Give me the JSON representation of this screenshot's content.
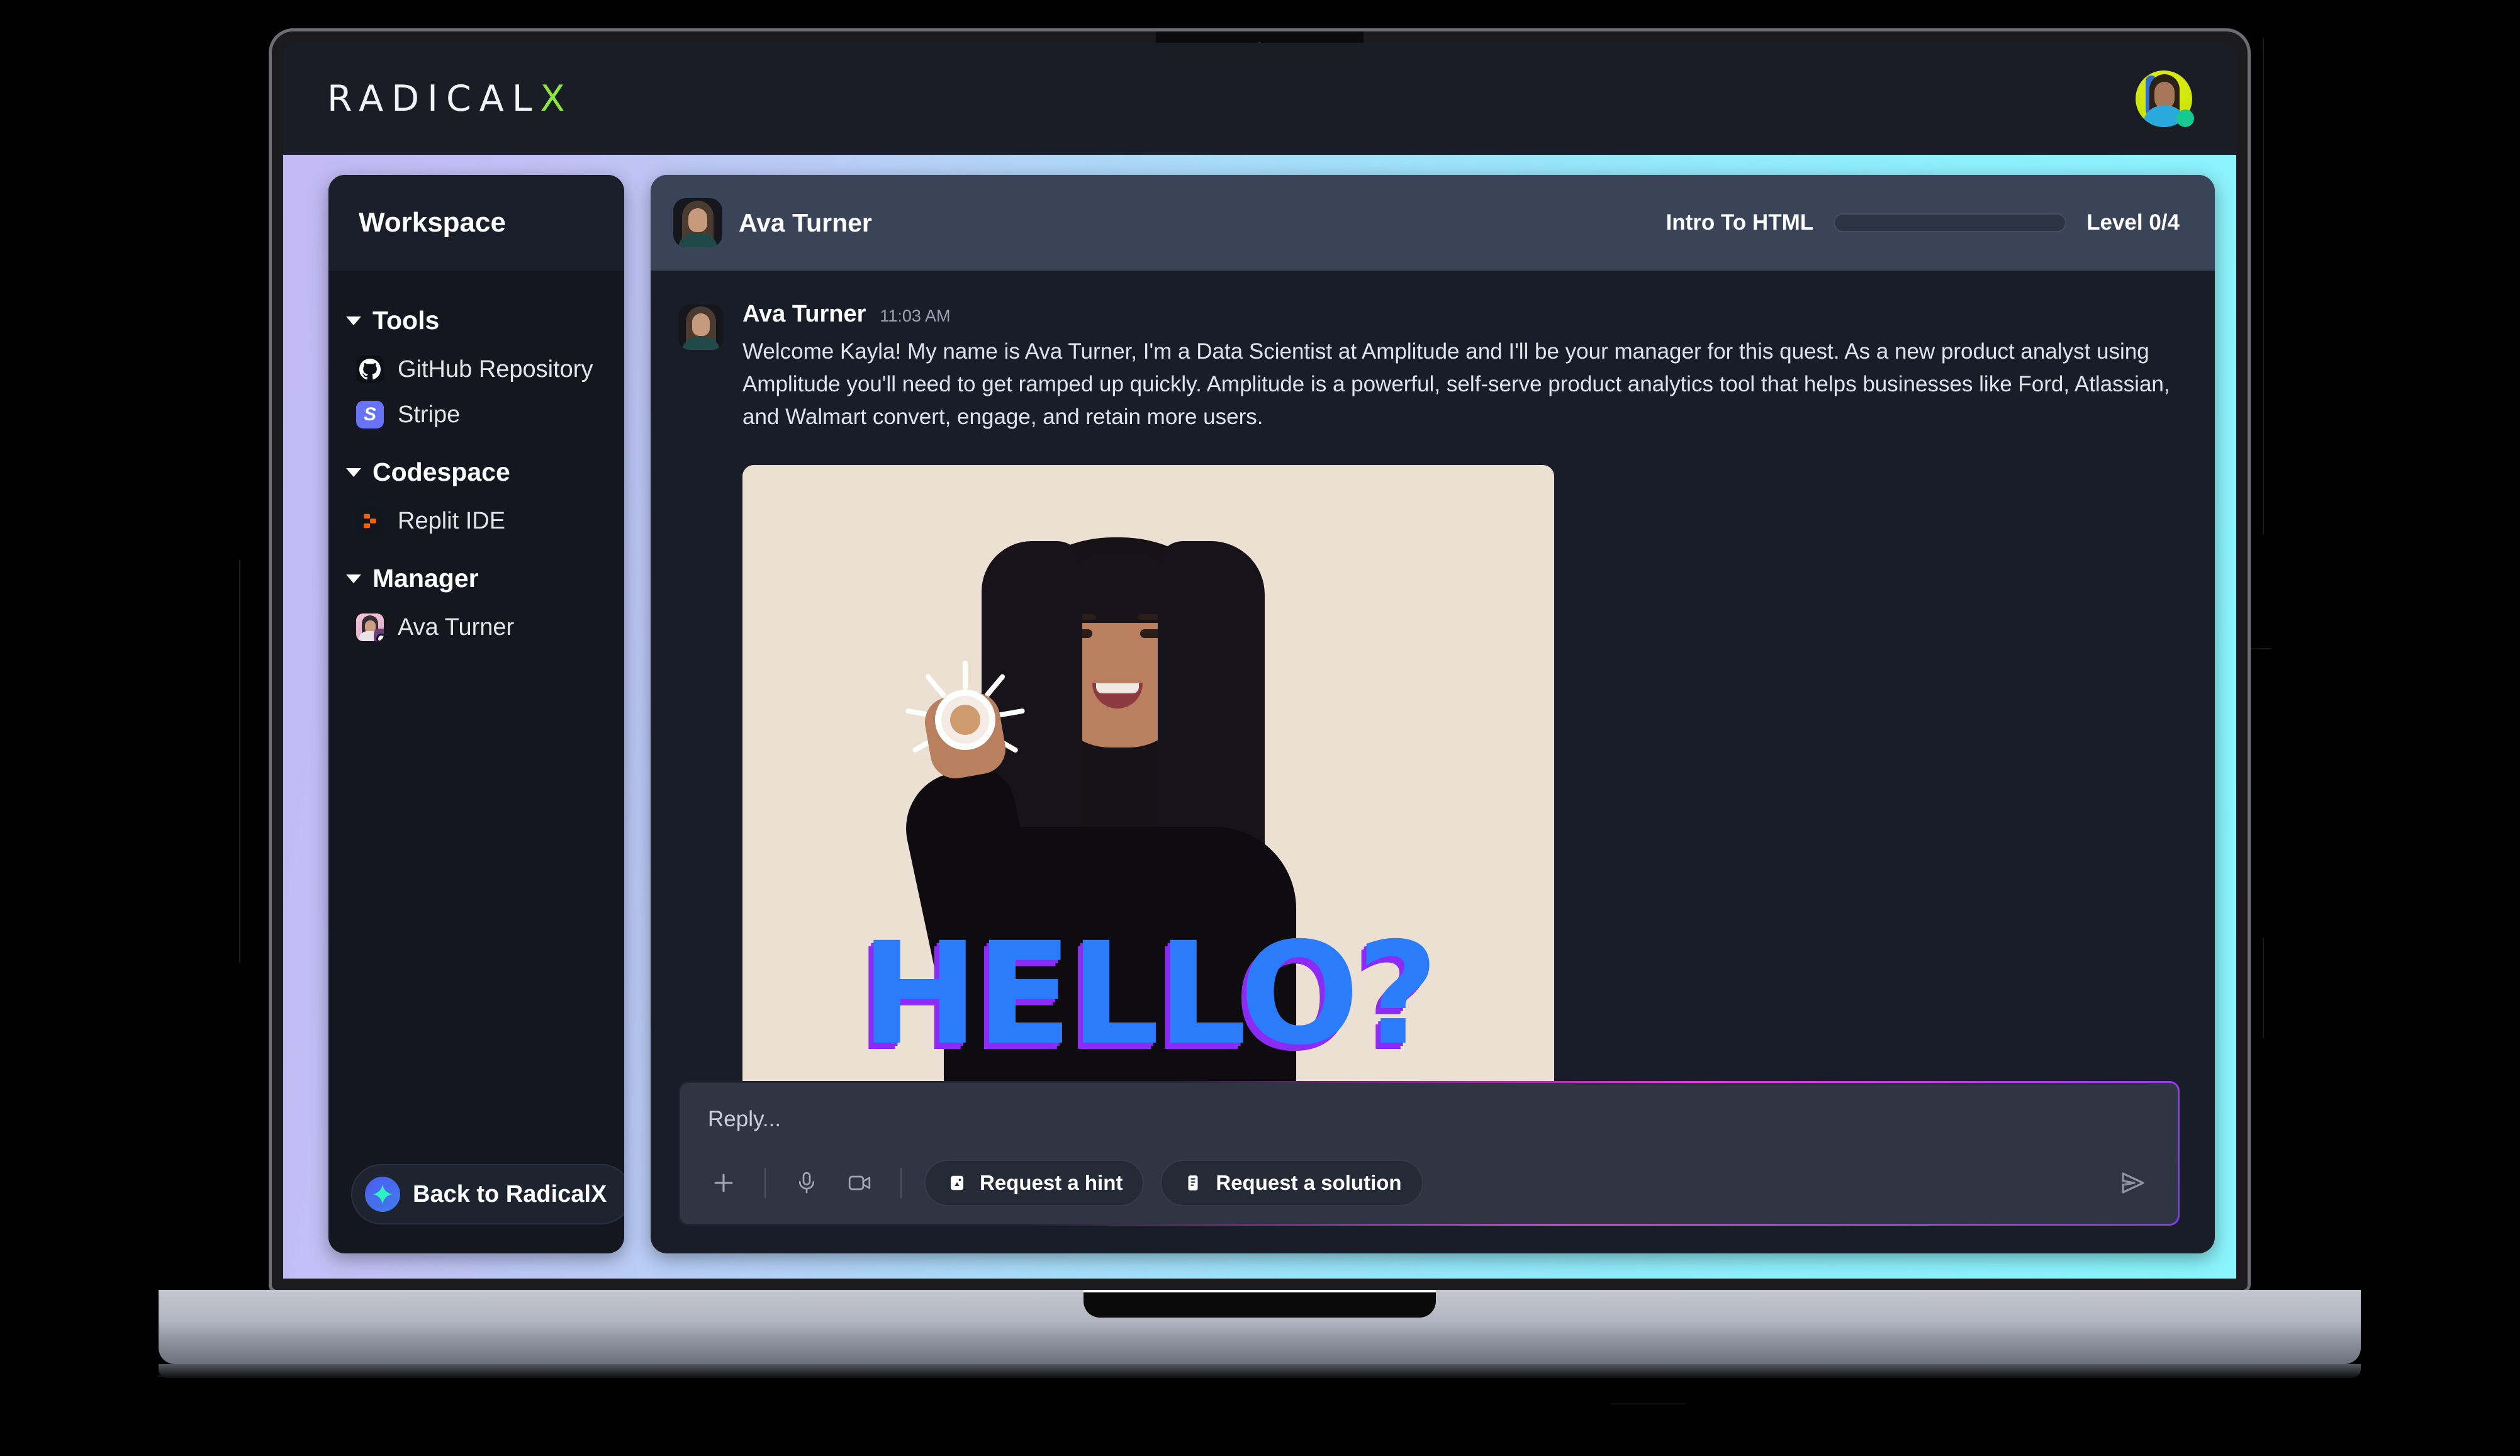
{
  "app": {
    "logo_main": "RADICAL",
    "logo_accent": "X",
    "logo_accent_color": "#8ce63c"
  },
  "user": {
    "avatar_name": "user-avatar",
    "status": "online",
    "status_color": "#15c98f"
  },
  "sidebar": {
    "header_title": "Workspace",
    "groups": [
      {
        "label": "Tools",
        "expanded": true,
        "items": [
          {
            "label": "GitHub Repository",
            "icon": "github-icon"
          },
          {
            "label": "Stripe",
            "icon": "stripe-icon"
          }
        ]
      },
      {
        "label": "Codespace",
        "expanded": true,
        "items": [
          {
            "label": "Replit IDE",
            "icon": "replit-icon"
          }
        ]
      },
      {
        "label": "Manager",
        "expanded": true,
        "items": [
          {
            "label": "Ava Turner",
            "icon": "ava-turner-avatar"
          }
        ]
      }
    ],
    "back_button": {
      "label": "Back to RadicalX",
      "icon": "radicalx-star-icon"
    }
  },
  "chat": {
    "header": {
      "contact_name": "Ava Turner",
      "quest_title": "Intro To HTML",
      "level_label": "Level 0/4",
      "progress_percent": 0
    },
    "message": {
      "author": "Ava Turner",
      "time": "11:03 AM",
      "body": "Welcome Kayla! My name is Ava Turner, I'm a Data Scientist at Amplitude and I'll be your manager for this quest. As a new product analyst using Amplitude you'll need to get ramped up quickly. Amplitude is a powerful, self-serve product analytics tool that helps businesses like Ford, Atlassian, and Walmart convert, engage, and retain more users.",
      "attachment": {
        "type": "gif",
        "caption_text": "HELLO?",
        "caption_color": "#2b7cfb",
        "caption_shadow_color": "#8c2bf5",
        "background_color": "#ece0d2"
      }
    },
    "composer": {
      "placeholder": "Reply...",
      "tools": [
        {
          "name": "add-attachment-icon"
        },
        {
          "name": "microphone-icon"
        },
        {
          "name": "video-camera-icon"
        }
      ],
      "hint_button": "Request a hint",
      "solution_button": "Request a solution",
      "send_icon": "send-icon",
      "accent_start": "#e838e0",
      "accent_end": "#7b3cf0"
    }
  }
}
